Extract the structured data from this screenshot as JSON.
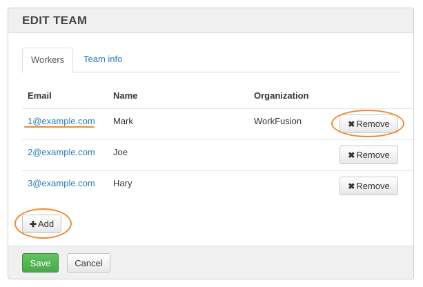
{
  "dialog": {
    "title": "EDIT TEAM"
  },
  "tabs": [
    {
      "label": "Workers",
      "active": true
    },
    {
      "label": "Team info",
      "active": false
    }
  ],
  "table": {
    "columns": [
      "Email",
      "Name",
      "Organization"
    ],
    "rows": [
      {
        "email": "1@example.com",
        "name": "Mark",
        "organization": "WorkFusion",
        "action": "Remove"
      },
      {
        "email": "2@example.com",
        "name": "Joe",
        "organization": "",
        "action": "Remove"
      },
      {
        "email": "3@example.com",
        "name": "Hary",
        "organization": "",
        "action": "Remove"
      }
    ]
  },
  "add_button": {
    "label": "Add",
    "icon": "plus-icon"
  },
  "remove_icon": "x-icon",
  "footer": {
    "save_label": "Save",
    "cancel_label": "Cancel"
  },
  "colors": {
    "link": "#2a7ab8",
    "save": "#5cb85c",
    "highlight": "#f08a2e"
  }
}
